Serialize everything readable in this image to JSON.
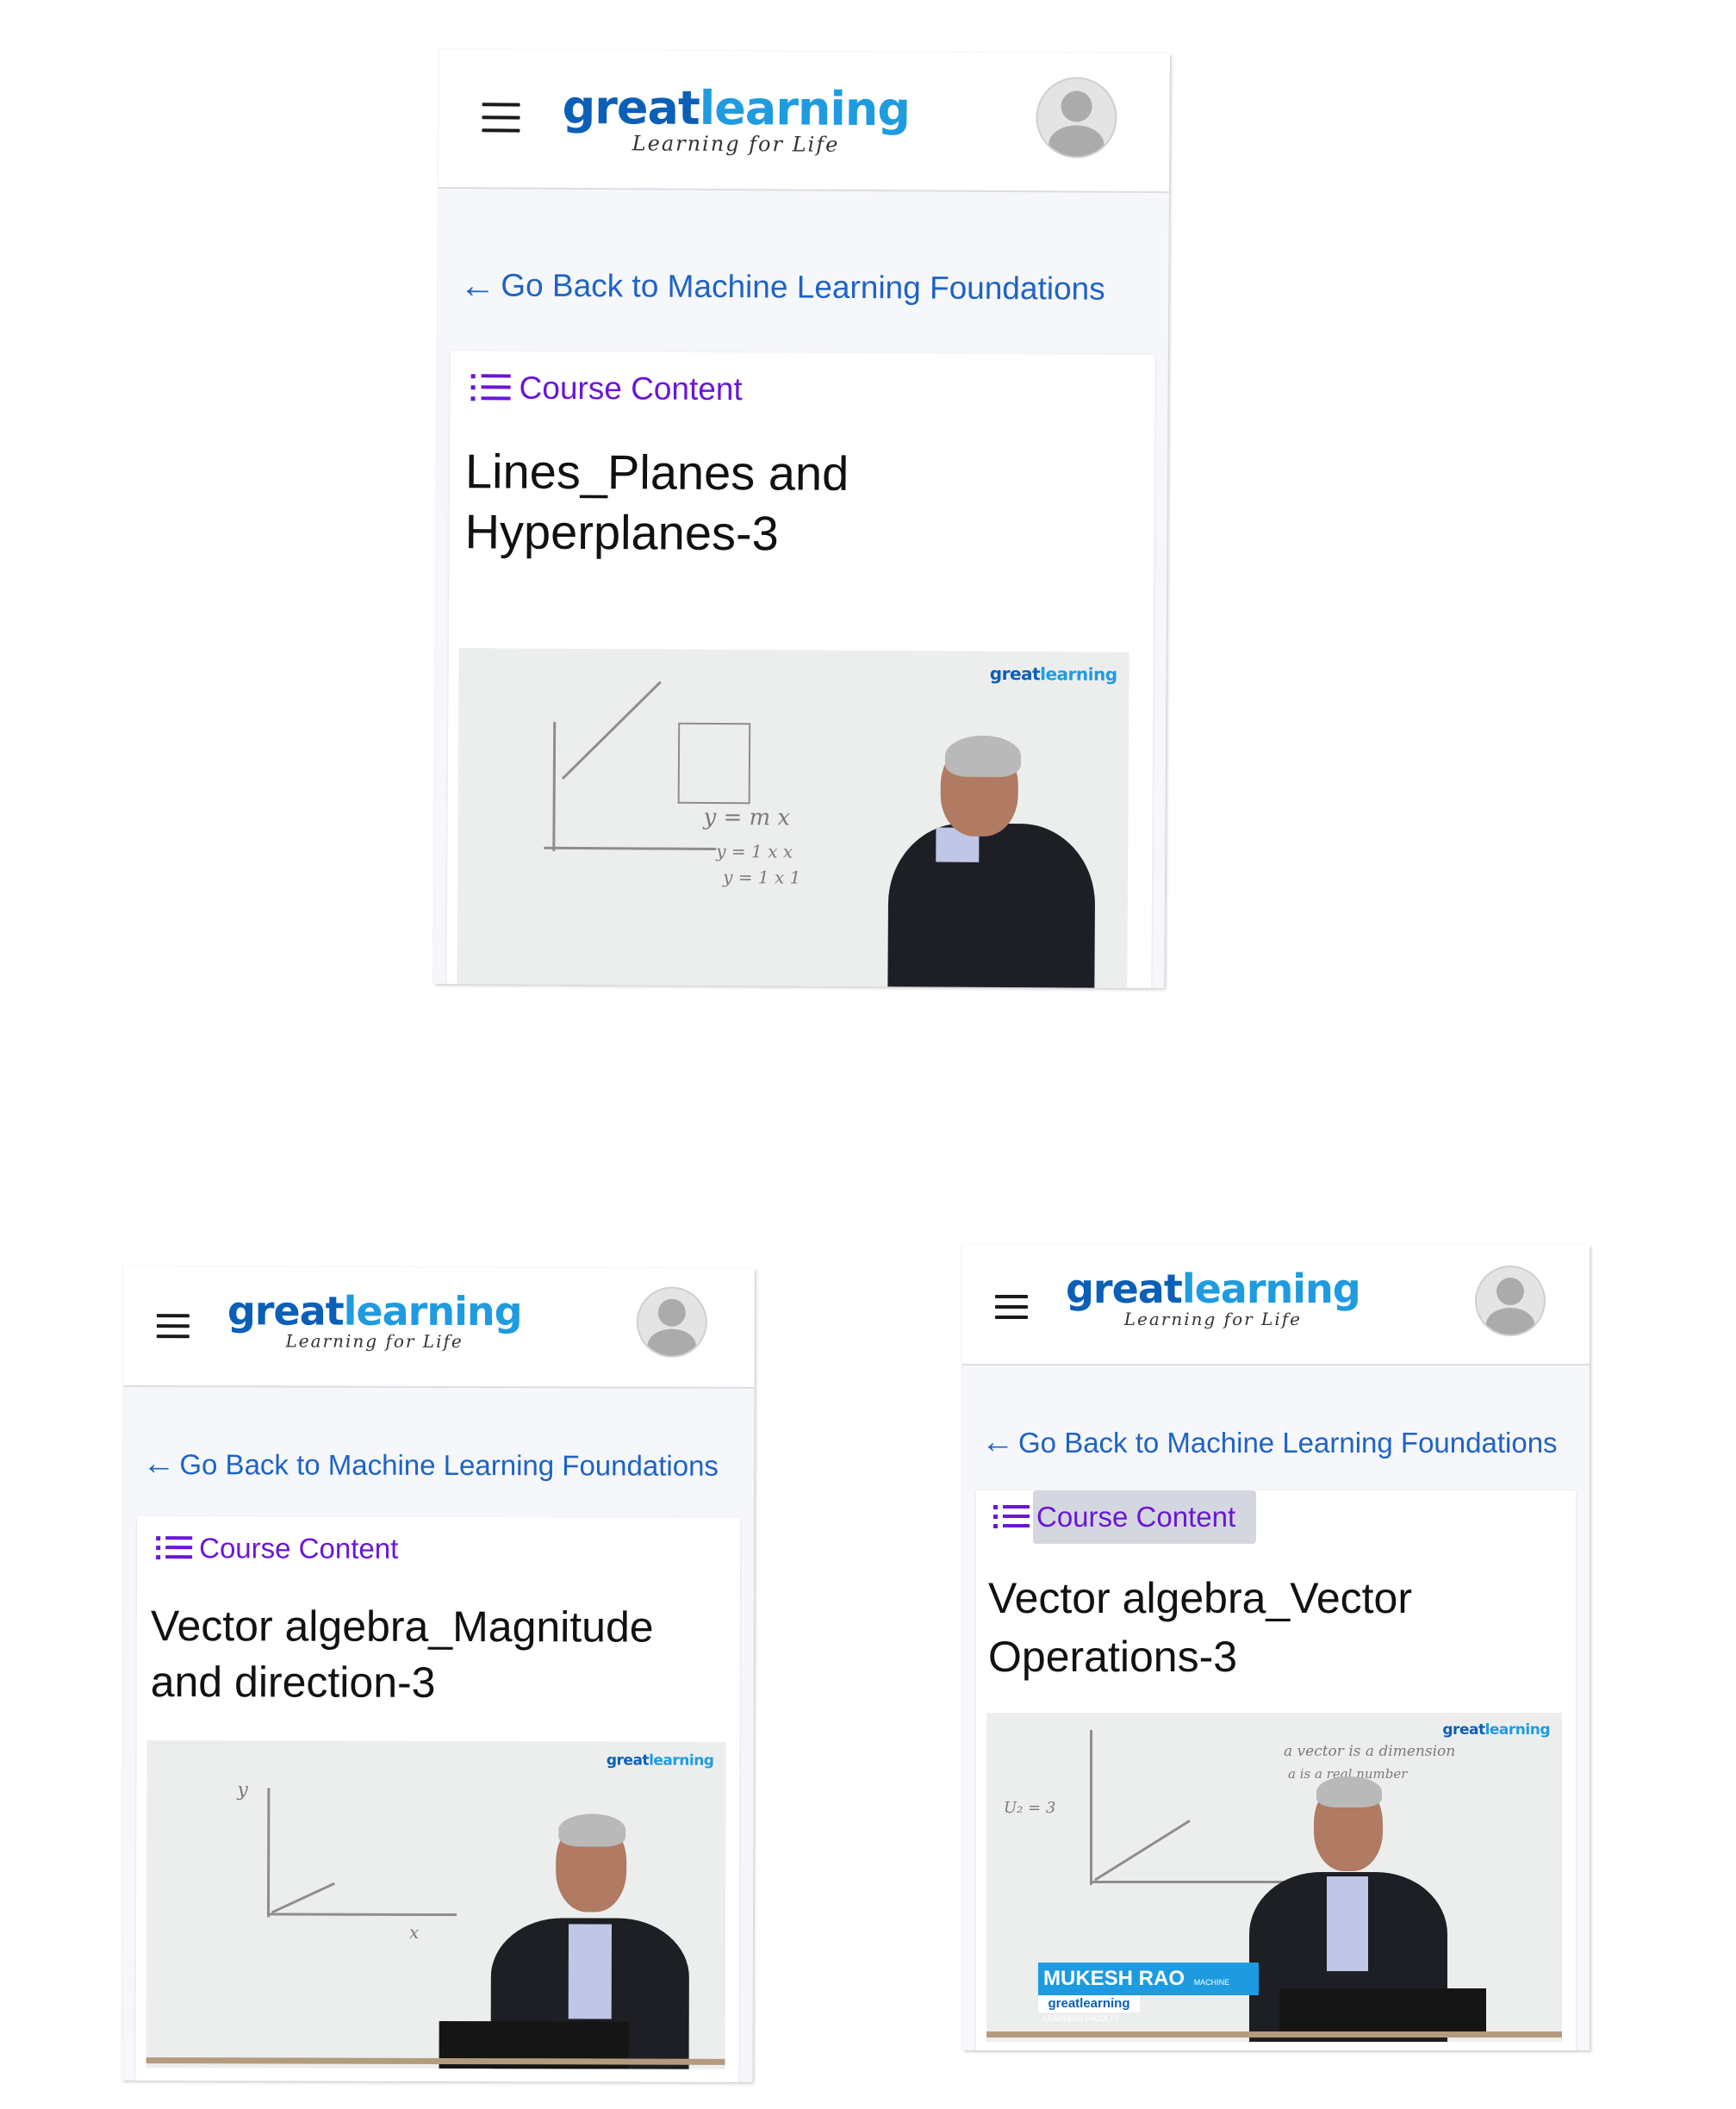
{
  "brand": {
    "logo_great": "great",
    "logo_learning": "learning",
    "tagline": "Learning for Life",
    "great_color": "#0b5fb7",
    "learning_color": "#1f9be0"
  },
  "icons": {
    "menu": "hamburger-menu-icon",
    "avatar": "user-avatar-icon",
    "back": "arrow-left-icon",
    "course_content": "list-icon"
  },
  "colors": {
    "link": "#1e63c6",
    "course_content": "#6b16d8"
  },
  "screens": [
    {
      "back_link": "Go Back to Machine Learning Foundations",
      "course_content_label": "Course Content",
      "lecture_title": "Lines_Planes and Hyperplanes-3",
      "video_logo": "greatlearning",
      "board_text": [
        "y = m x",
        "y = 1 x x",
        "y = 1 x 1"
      ]
    },
    {
      "back_link": "Go Back to Machine Learning Foundations",
      "course_content_label": "Course Content",
      "lecture_title": "Vector algebra_Magnitude and direction-3",
      "video_logo": "greatlearning",
      "board_text": [
        "y",
        "x"
      ]
    },
    {
      "back_link": "Go Back to Machine Learning Foundations",
      "course_content_label": "Course Content",
      "lecture_title": "Vector algebra_Vector Operations-3",
      "video_logo": "greatlearning",
      "board_text": [
        "a vector is a dimension",
        "a is a real number",
        "U₂ = 3"
      ],
      "presenter_name": "MUKESH RAO",
      "presenter_role": "MACHINE LEARNING FACULTY",
      "presenter_org": "greatlearning"
    }
  ]
}
